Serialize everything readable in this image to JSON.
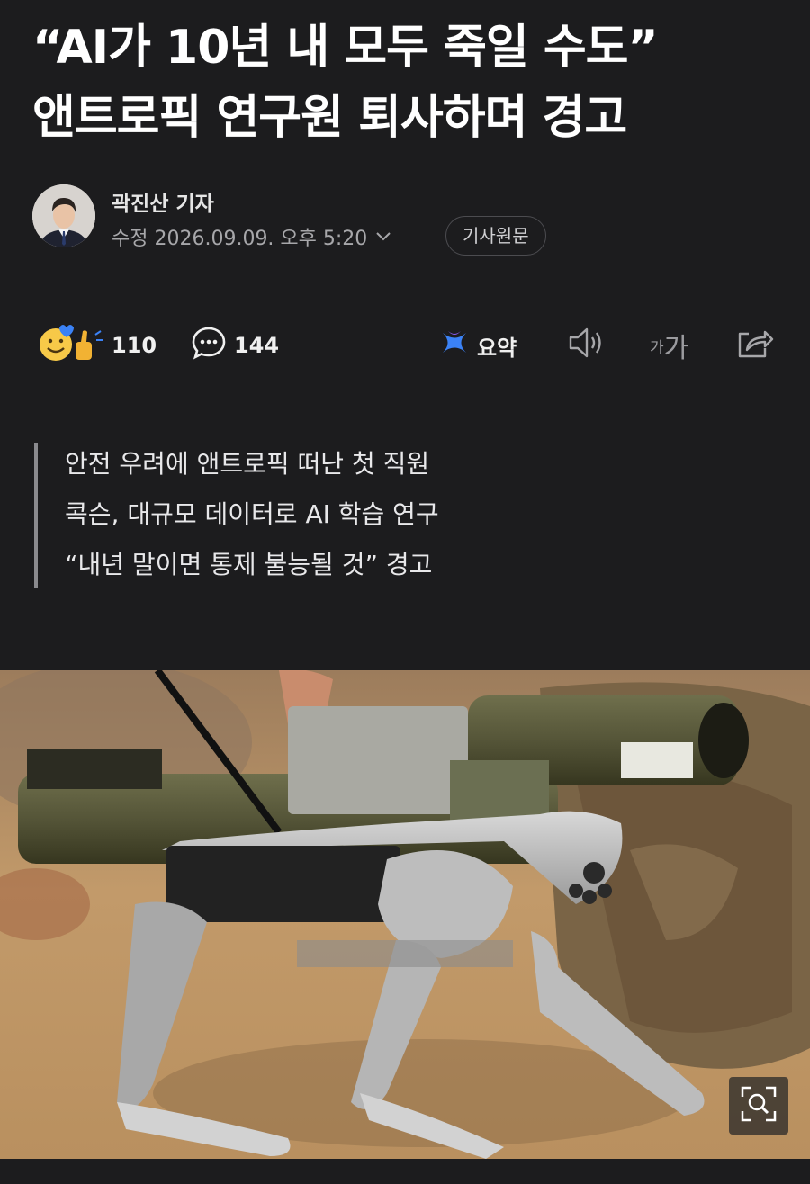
{
  "article": {
    "headline_line1": "“AI가 10년 내 모두 죽일 수도”",
    "headline_line2": "앤트로픽 연구원 퇴사하며 경고",
    "reporter": "곽진산 기자",
    "edited_date": "수정 2026.09.09. 오후 5:20",
    "original_article_label": "기사원문",
    "summary_lines": [
      "안전 우려에 앤트로픽 떠난 첫 직원",
      "콕슨, 대규모 데이터로 AI 학습 연구",
      "“내년 말이면 통제 불능될 것” 경고"
    ]
  },
  "actions": {
    "reaction_count": "110",
    "comment_count": "144",
    "summary_label": "요약",
    "font_small": "가",
    "font_big": "가"
  },
  "icons": {
    "reaction": "smile-thumbs-up-icon",
    "comment": "speech-bubble-icon",
    "summary": "ai-summary-icon",
    "audio": "speaker-icon",
    "share": "share-icon",
    "zoom": "zoom-icon",
    "chevron": "chevron-down-icon"
  },
  "colors": {
    "background": "#1c1c1e",
    "summary_accent": "#3b82f6",
    "reaction_yellow": "#f7c948"
  }
}
